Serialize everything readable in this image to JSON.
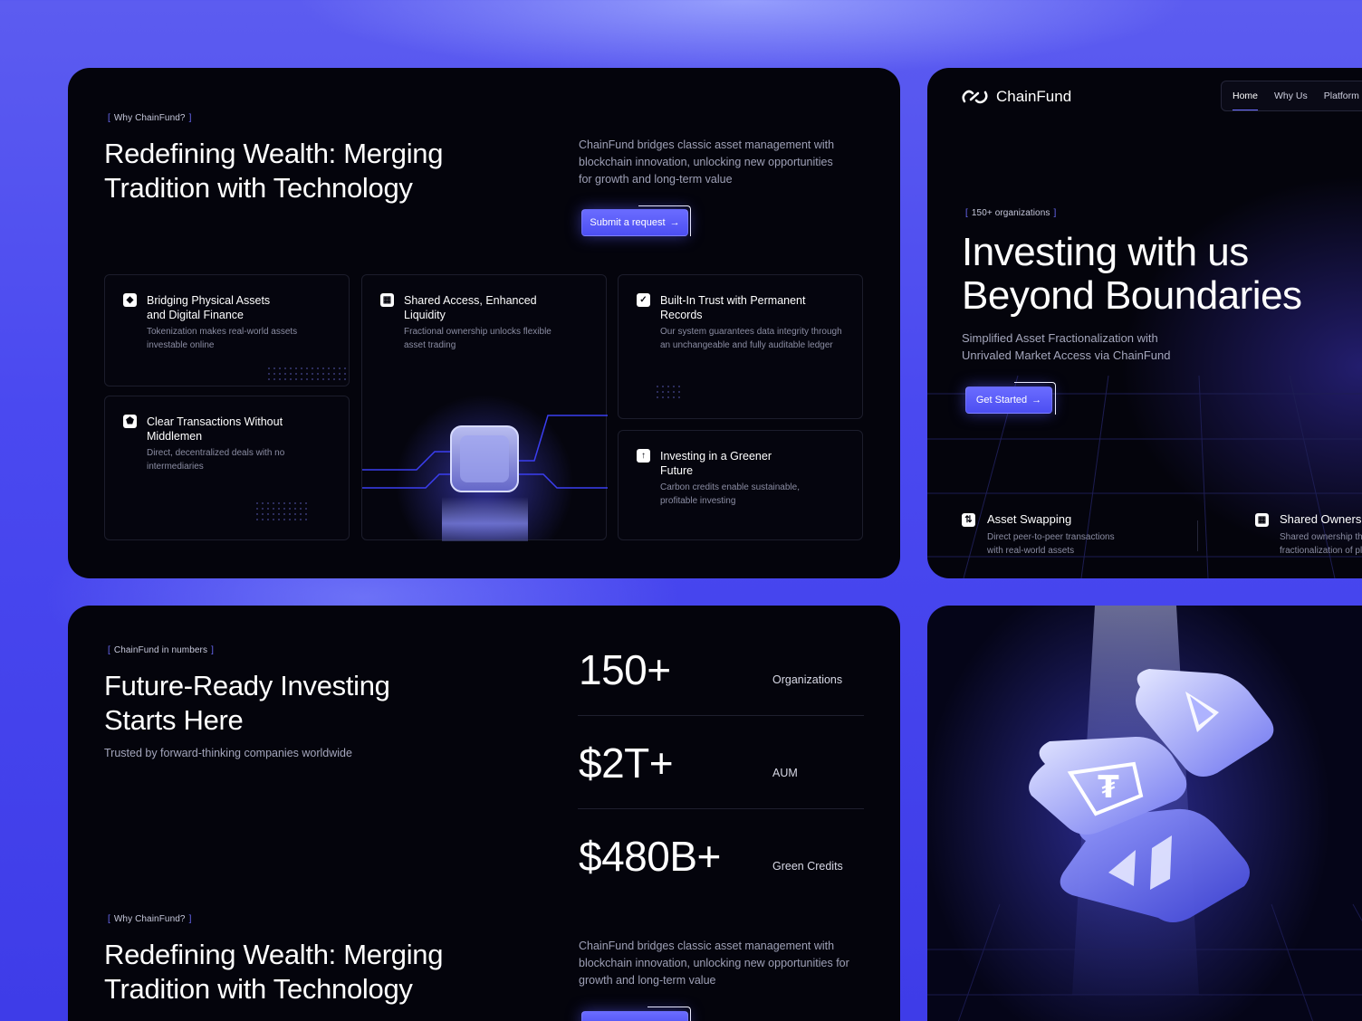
{
  "why": {
    "tag": "Why ChainFund?",
    "title_line1": "Redefining Wealth: Merging",
    "title_line2": "Tradition with Technology",
    "desc_line1": "ChainFund bridges classic asset management with",
    "desc_line2": "blockchain innovation, unlocking new opportunities",
    "desc_line3": "for growth and long-term value",
    "cta": "Submit a request",
    "features": [
      {
        "title1": "Bridging Physical Assets",
        "title2": "and Digital Finance",
        "desc1": "Tokenization makes real-world assets",
        "desc2": "investable online"
      },
      {
        "title1": "Shared Access, Enhanced",
        "title2": "Liquidity",
        "desc1": "Fractional ownership unlocks flexible",
        "desc2": "asset trading"
      },
      {
        "title1": "Built-In Trust with Permanent",
        "title2": "Records",
        "desc1": "Our system guarantees data integrity through",
        "desc2": "an unchangeable and fully auditable ledger"
      },
      {
        "title1": "Clear Transactions Without",
        "title2": "Middlemen",
        "desc1": "Direct, decentralized deals with no",
        "desc2": "intermediaries"
      },
      {
        "title1": "Investing in a Greener",
        "title2": "Future",
        "desc1": "Carbon credits enable sustainable,",
        "desc2": "profitable investing"
      }
    ]
  },
  "hero": {
    "brand": "ChainFund",
    "nav": [
      "Home",
      "Why Us",
      "Platform"
    ],
    "tag": "150+ organizations",
    "title_line1": "Investing with us",
    "title_line2": "Beyond Boundaries",
    "sub_line1": "Simplified Asset Fractionalization with",
    "sub_line2": "Unrivaled Market Access via ChainFund",
    "cta": "Get Started",
    "features": [
      {
        "title": "Asset Swapping",
        "desc1": "Direct peer-to-peer transactions",
        "desc2": "with real-world assets"
      },
      {
        "title": "Shared Owners",
        "desc1": "Shared ownership th",
        "desc2": "fractionalization of pl"
      }
    ]
  },
  "numbers": {
    "tag": "ChainFund in numbers",
    "title_line1": "Future-Ready Investing",
    "title_line2": "Starts Here",
    "subtitle": "Trusted by forward-thinking companies worldwide",
    "stats": [
      {
        "value": "150+",
        "label": "Organizations"
      },
      {
        "value": "$2T+",
        "label": "AUM"
      },
      {
        "value": "$480B+",
        "label": "Green Credits"
      }
    ],
    "why_tag": "Why ChainFund?",
    "why_title_line1": "Redefining Wealth: Merging",
    "why_title_line2": "Tradition with Technology",
    "why_desc_line1": "ChainFund bridges classic asset management with",
    "why_desc_line2": "blockchain innovation, unlocking new opportunities for",
    "why_desc_line3": "growth and long-term value"
  },
  "icons": {
    "feature_1": "building-icon",
    "feature_2": "grid-icon",
    "feature_3": "check-badge-icon",
    "feature_4": "shield-icon",
    "feature_5": "arrow-up-icon",
    "hero_feature_1": "swap-icon",
    "hero_feature_2": "grid-icon",
    "logo": "chain-link-icon",
    "coins": [
      "ethereum-coin-icon",
      "tether-coin-icon",
      "token-coin-icon"
    ]
  },
  "colors": {
    "accent": "#5b5df8",
    "background": "#4a49f0",
    "card": "#04040c"
  }
}
